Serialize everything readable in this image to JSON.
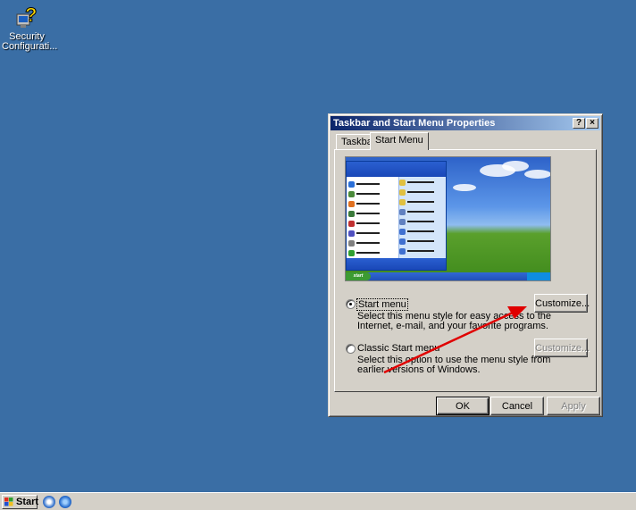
{
  "desktop": {
    "icons": [
      {
        "label": "Security Configurati...",
        "icon": "security-config-icon"
      }
    ],
    "background": "#3a6ea5"
  },
  "dialog": {
    "title": "Taskbar and Start Menu Properties",
    "help_label": "?",
    "close_label": "×",
    "tabs": [
      {
        "label": "Taskbar",
        "active": false
      },
      {
        "label": "Start Menu",
        "active": true
      }
    ],
    "options": [
      {
        "label": "Start menu",
        "selected": true,
        "description_1": "Select this menu style for easy access to the",
        "description_2": "Internet, e-mail, and your favorite programs.",
        "customize_label": "Customize...",
        "customize_enabled": true
      },
      {
        "label": "Classic Start menu",
        "selected": false,
        "description_1": "Select this option to use the menu style from",
        "description_2": "earlier versions of Windows.",
        "customize_label": "Customize...",
        "customize_enabled": false
      }
    ],
    "buttons": {
      "ok": "OK",
      "cancel": "Cancel",
      "apply": "Apply"
    },
    "annotation_color": "#e00000"
  },
  "taskbar": {
    "start_label": "Start",
    "quick_launch": [
      "show-desktop-icon",
      "internet-explorer-icon"
    ]
  }
}
